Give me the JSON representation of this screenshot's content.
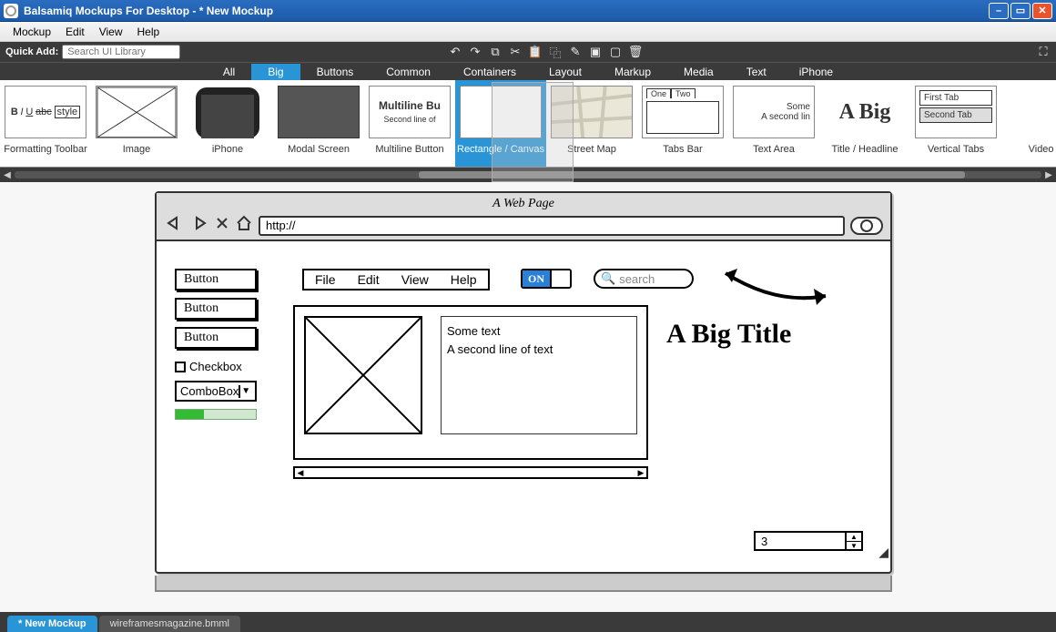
{
  "window": {
    "title": "Balsamiq Mockups For Desktop - * New Mockup"
  },
  "menubar": {
    "items": [
      "Mockup",
      "Edit",
      "View",
      "Help"
    ]
  },
  "toolbar": {
    "quick_label": "Quick Add:",
    "quick_placeholder": "Search UI Library"
  },
  "categories": {
    "items": [
      "All",
      "Big",
      "Buttons",
      "Common",
      "Containers",
      "Layout",
      "Markup",
      "Media",
      "Text",
      "iPhone"
    ],
    "active_index": 1
  },
  "library": {
    "items": [
      {
        "label": "Formatting Toolbar"
      },
      {
        "label": "Image"
      },
      {
        "label": "iPhone"
      },
      {
        "label": "Modal Screen"
      },
      {
        "label": "Multiline Button",
        "line1": "Multiline Bu",
        "line2": "Second line of"
      },
      {
        "label": "Rectangle / Canvas",
        "selected": true
      },
      {
        "label": "Street Map"
      },
      {
        "label": "Tabs Bar",
        "tab1": "One",
        "tab2": "Two"
      },
      {
        "label": "Text Area",
        "ta1": "Some",
        "ta2": "A second lin"
      },
      {
        "label": "Title / Headline",
        "h": "A Big"
      },
      {
        "label": "Vertical Tabs",
        "vt1": "First Tab",
        "vt2": "Second Tab"
      },
      {
        "label": "Video Pl"
      }
    ]
  },
  "mockup": {
    "browser_title": "A Web Page",
    "url": "http://",
    "buttons": [
      "Button",
      "Button",
      "Button"
    ],
    "checkbox_label": "Checkbox",
    "combo_label": "ComboBox",
    "menu": [
      "File",
      "Edit",
      "View",
      "Help"
    ],
    "toggle_on": "ON",
    "search_placeholder": "search",
    "big_title": "A Big Title",
    "text_line1": "Some text",
    "text_line2": "A second line of text",
    "stepper_value": "3"
  },
  "doc_tabs": {
    "items": [
      "* New Mockup",
      "wireframesmagazine.bmml"
    ],
    "active_index": 0
  }
}
